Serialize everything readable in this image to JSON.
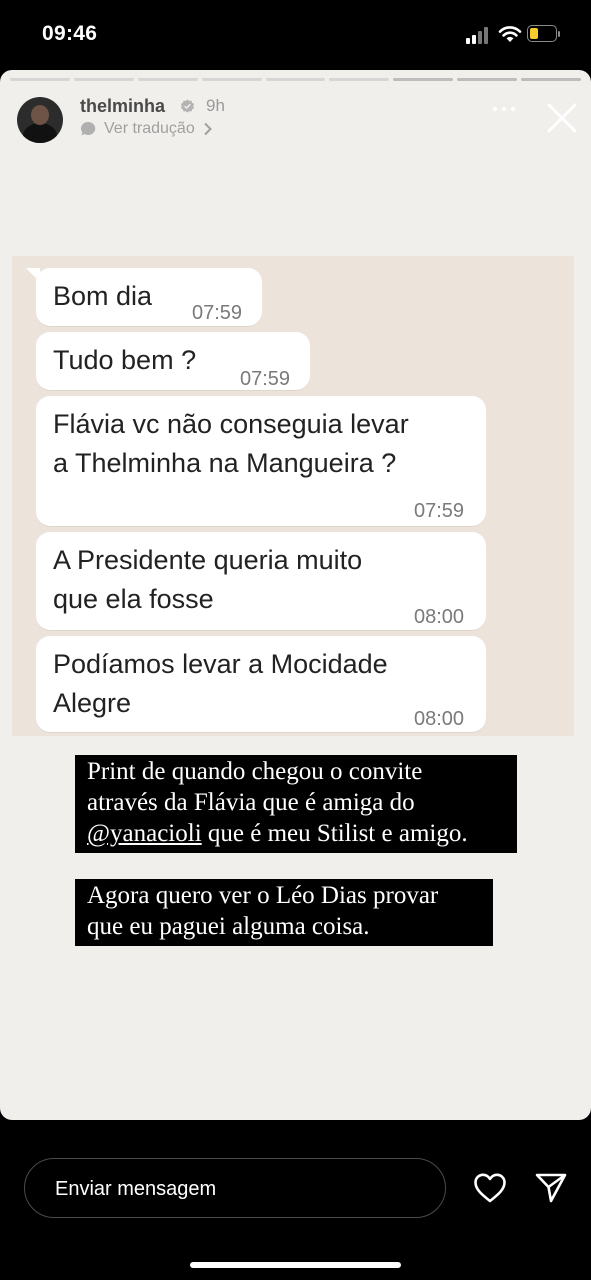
{
  "status_bar": {
    "time": "09:46"
  },
  "story": {
    "username": "thelminha",
    "time_ago": "9h",
    "translate_label": "Ver tradução",
    "progress_segments": 9
  },
  "chat": {
    "messages": [
      {
        "text": "Bom dia",
        "time": "07:59"
      },
      {
        "text": "Tudo bem ?",
        "time": "07:59"
      },
      {
        "text": "Flávia vc não conseguia levar\na Thelminha na Mangueira ?",
        "time": "07:59"
      },
      {
        "text": "A Presidente queria muito\nque ela fosse",
        "time": "08:00"
      },
      {
        "text": "Podíamos levar a Mocidade\nAlegre",
        "time": "08:00"
      }
    ]
  },
  "captions": {
    "caption1": {
      "line1": "Print de quando chegou o convite",
      "line2": "através da Flávia que é amiga do",
      "mention": "@yanacioli",
      "line3_rest": " que é meu Stilist e amigo."
    },
    "caption2": {
      "line1": "Agora quero ver o Léo Dias provar",
      "line2": "que eu paguei alguma coisa."
    }
  },
  "reply": {
    "placeholder": "Enviar mensagem"
  },
  "icons": {
    "verified": "verified-badge-icon",
    "translate": "speech-bubble-icon",
    "more": "more-dots-icon",
    "close": "close-icon",
    "heart": "heart-icon",
    "send": "send-icon"
  }
}
